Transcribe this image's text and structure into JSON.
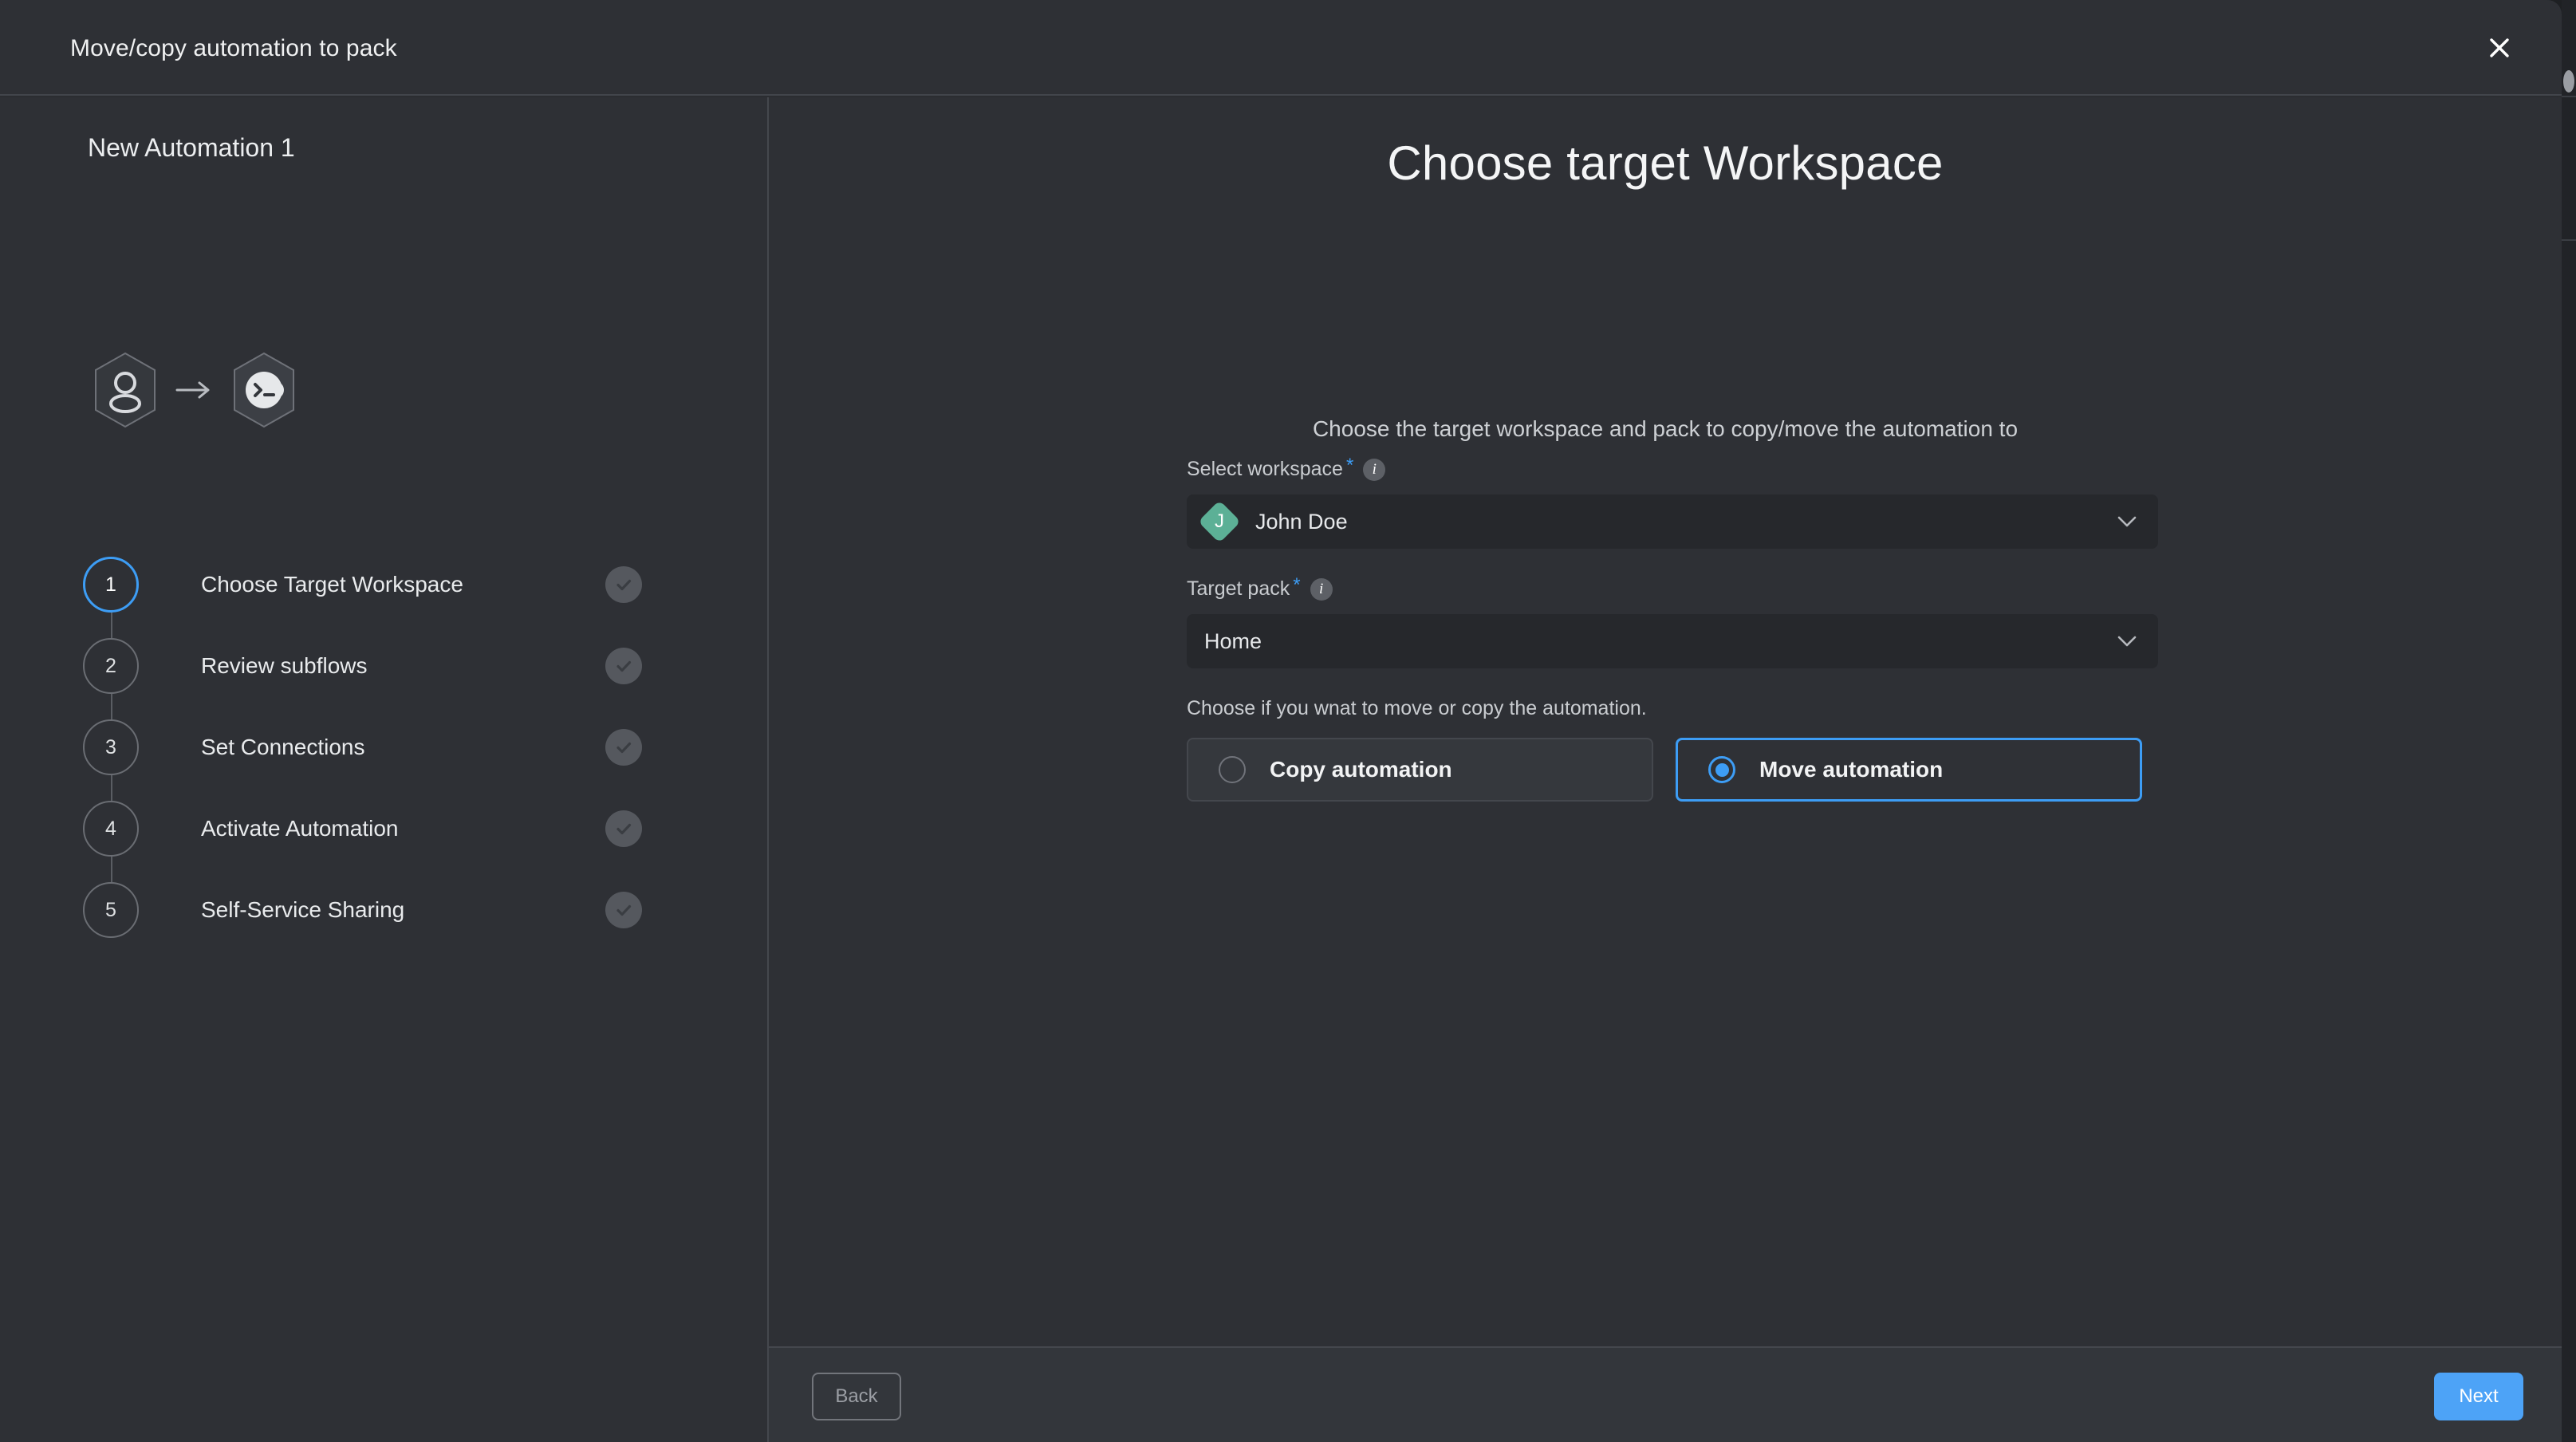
{
  "window": {
    "title": "Move/copy automation to pack",
    "close_icon": "close-icon"
  },
  "sidebar": {
    "flow_name": "New Automation 1",
    "flow_icons": {
      "source_icon": "user-icon",
      "arrow_icon": "arrow-right-icon",
      "target_icon": "terminal-bot-icon"
    },
    "steps": [
      {
        "number": "1",
        "label": "Choose Target Workspace",
        "active": true
      },
      {
        "number": "2",
        "label": "Review subflows",
        "active": false
      },
      {
        "number": "3",
        "label": "Set Connections",
        "active": false
      },
      {
        "number": "4",
        "label": "Activate Automation",
        "active": false
      },
      {
        "number": "5",
        "label": "Self-Service Sharing",
        "active": false
      }
    ]
  },
  "main": {
    "heading": "Choose target Workspace",
    "subtitle": "Choose the target workspace and pack to copy/move the automation to",
    "fields": {
      "workspace": {
        "label": "Select workspace",
        "required_marker": "*",
        "info_glyph": "i",
        "value": "John Doe",
        "avatar_initial": "J",
        "avatar_color": "#5cb096"
      },
      "pack": {
        "label": "Target pack",
        "required_marker": "*",
        "info_glyph": "i",
        "value": "Home"
      }
    },
    "mode": {
      "note": "Choose if you wnat to move or copy the automation.",
      "options": [
        {
          "label": "Copy automation",
          "selected": false
        },
        {
          "label": "Move automation",
          "selected": true
        }
      ]
    }
  },
  "footer": {
    "back_label": "Back",
    "next_label": "Next"
  },
  "colors": {
    "accent": "#3d9df5",
    "next_button": "#4da3f7",
    "panel": "#2e3035",
    "field": "#26282c",
    "avatar": "#5cb096"
  }
}
